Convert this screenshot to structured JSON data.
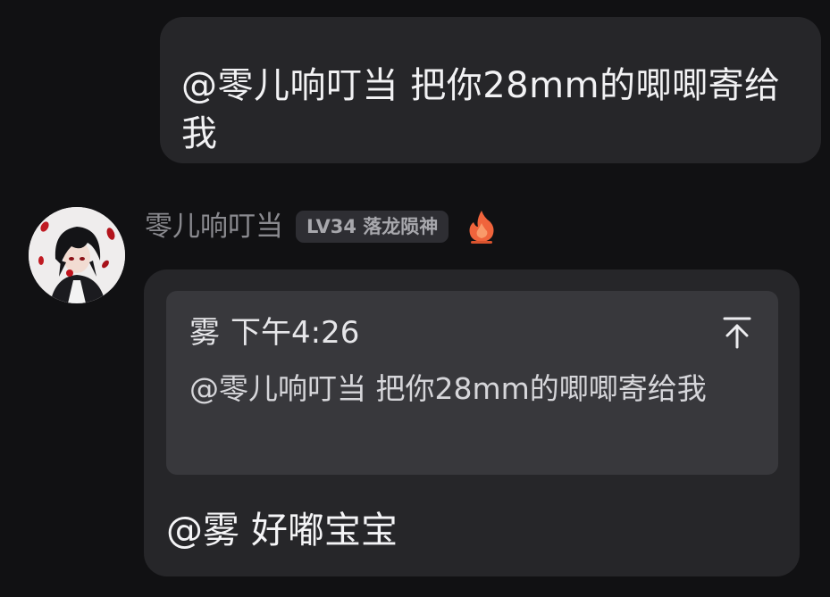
{
  "messages": {
    "top": {
      "text": "@零儿响叮当 把你28mm的唧唧寄给我"
    },
    "main": {
      "sender": {
        "name": "零儿响叮当",
        "level_badge": "LV34 落龙陨神",
        "flame_icon": "flame-icon",
        "avatar_icon": "avatar"
      },
      "quote": {
        "author": "雾",
        "time": "下午4:26",
        "text": "@零儿响叮当 把你28mm的唧唧寄给我",
        "jump_icon": "jump-to-top-icon"
      },
      "reply_text": "@雾 好嘟宝宝"
    }
  },
  "colors": {
    "background": "#111113",
    "bubble": "#262629",
    "quote_box": "#38383c",
    "badge": "#2e2e33",
    "flame": "#f0643c",
    "name": "#8a8a8f"
  }
}
